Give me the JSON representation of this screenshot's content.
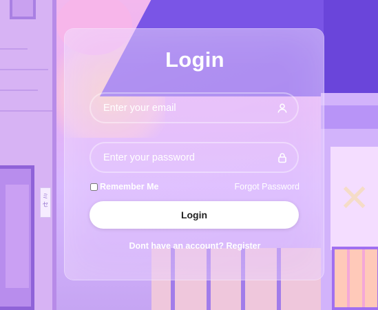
{
  "login": {
    "title": "Login",
    "email": {
      "placeholder": "Enter your email",
      "value": "",
      "icon": "user-icon"
    },
    "password": {
      "placeholder": "Enter your password",
      "value": "",
      "icon": "lock-icon"
    },
    "remember_label": "Remember Me",
    "remember_checked": false,
    "forgot_label": "Forgot Password",
    "submit_label": "Login",
    "register_prompt": "Dont have an account?",
    "register_link": "Register"
  },
  "colors": {
    "accent": "#7a55e6",
    "text": "#ffffff",
    "button_bg": "#ffffff",
    "button_text": "#222222"
  }
}
